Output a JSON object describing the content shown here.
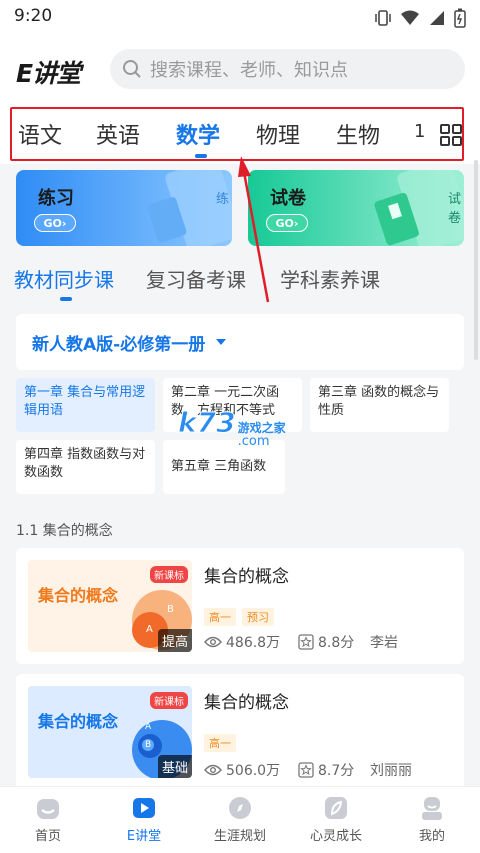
{
  "status": {
    "time": "9:20"
  },
  "header": {
    "logo": "E讲堂",
    "search_placeholder": "搜索课程、老师、知识点"
  },
  "subjects": {
    "items": [
      "语文",
      "英语",
      "数学",
      "物理",
      "生物",
      "1"
    ],
    "active": "数学"
  },
  "cards": [
    {
      "label": "练习",
      "go": "GO›",
      "watermark": "练"
    },
    {
      "label": "试卷",
      "go": "GO›",
      "watermark": "试卷"
    }
  ],
  "course_tabs": {
    "items": [
      "教材同步课",
      "复习备考课",
      "学科素养课"
    ],
    "active": "教材同步课"
  },
  "edition": {
    "label": "新人教A版-必修第一册"
  },
  "chapters": [
    "第一章 集合与常用逻辑用语",
    "第二章 一元二次函数、方程和不等式",
    "第三章 函数的概念与性质",
    "第四章 指数函数与对数函数",
    "第五章 三角函数"
  ],
  "section_title": "1.1 集合的概念",
  "watermark": {
    "brand": "k73",
    "sub": "游戏之家",
    "domain": ".com"
  },
  "lessons": [
    {
      "thumb_title": "集合的概念",
      "badge": "新课标",
      "level": "提高",
      "title": "集合的概念",
      "tags": [
        "高一",
        "预习"
      ],
      "views": "486.8万",
      "score": "8.8分",
      "teacher": "李岩",
      "diagram_a": "A",
      "diagram_b": "B"
    },
    {
      "thumb_title": "集合的概念",
      "badge": "新课标",
      "level": "基础",
      "title": "集合的概念",
      "tags": [
        "高一"
      ],
      "views": "506.0万",
      "score": "8.7分",
      "teacher": "刘丽丽",
      "diagram_a": "A",
      "diagram_b": "B"
    }
  ],
  "nav": {
    "items": [
      "首页",
      "E讲堂",
      "生涯规划",
      "心灵成长",
      "我的"
    ],
    "active": "E讲堂"
  },
  "colors": {
    "accent": "#1677e8",
    "highlight": "#e01e2a"
  }
}
